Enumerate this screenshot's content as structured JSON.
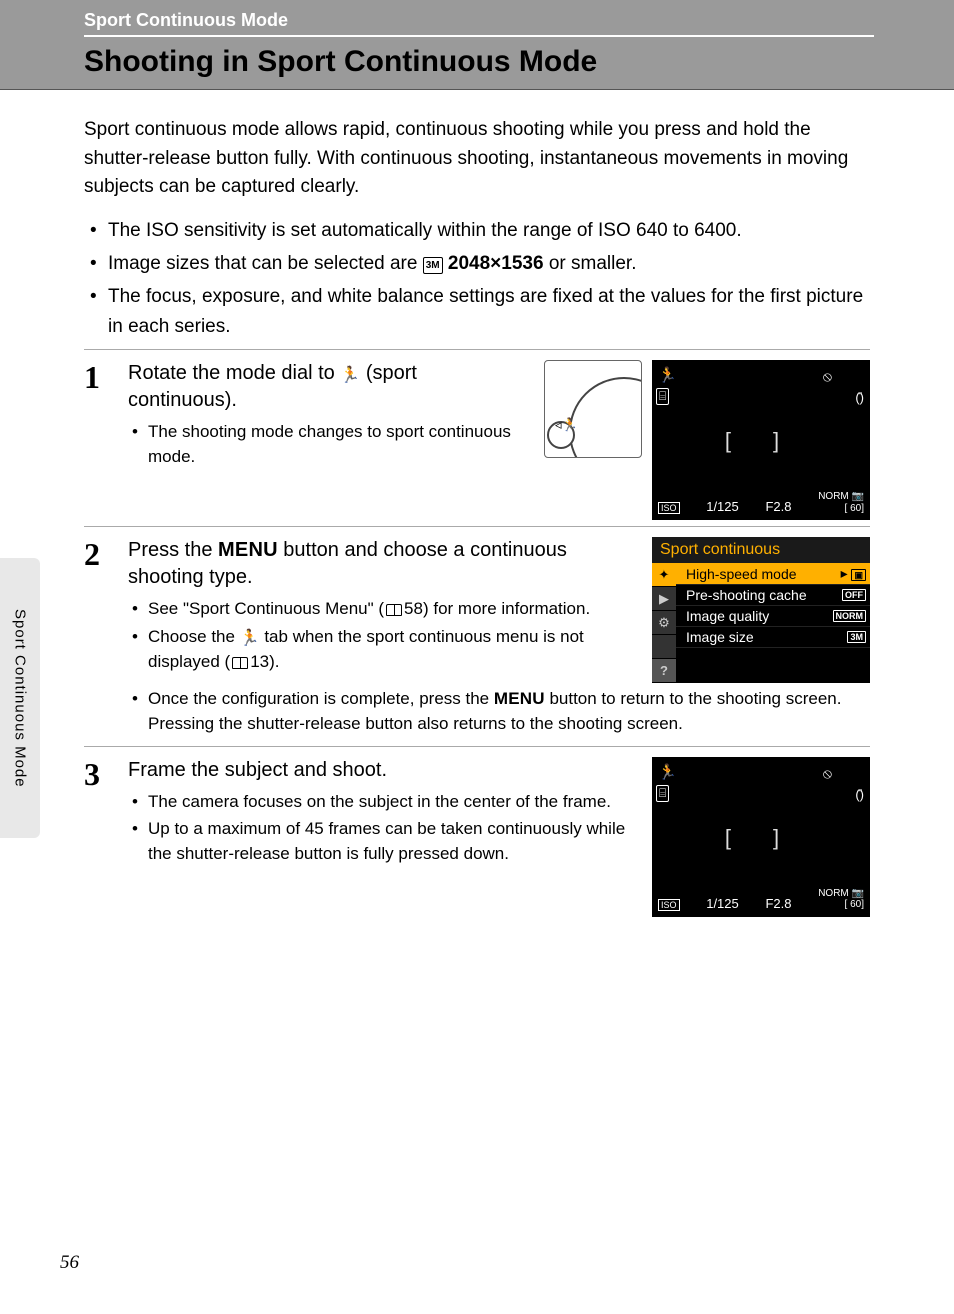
{
  "header": {
    "section": "Sport Continuous Mode",
    "title": "Shooting in Sport Continuous Mode"
  },
  "intro": "Sport continuous mode allows rapid, continuous shooting while you press and hold the shutter-release button fully. With continuous shooting, instantaneous movements in moving subjects can be captured clearly.",
  "intro_bullets": {
    "b1": "The ISO sensitivity is set automatically within the range of ISO 640 to 6400.",
    "b2_a": "Image sizes that can be selected are ",
    "b2_icon": "3M",
    "b2_b": " 2048×1536",
    "b2_c": " or smaller.",
    "b3": "The focus, exposure, and white balance settings are fixed at the values for the first picture in each series."
  },
  "steps": {
    "s1": {
      "num": "1",
      "title_a": "Rotate the mode dial to ",
      "title_b": " (sport continuous).",
      "bullets": {
        "b1": "The shooting mode changes to sport continuous mode."
      }
    },
    "s2": {
      "num": "2",
      "title_a": "Press the ",
      "title_menu": "MENU",
      "title_b": " button and choose a continuous shooting type.",
      "bullets": {
        "b1_a": "See \"Sport Continuous Menu\" (",
        "b1_ref": "58",
        "b1_b": ") for more information.",
        "b2_a": "Choose the ",
        "b2_b": " tab when the sport continuous menu is not displayed (",
        "b2_ref": "13",
        "b2_c": ").",
        "b3_a": "Once the configuration is complete, press the ",
        "b3_menu": "MENU",
        "b3_b": " button to return to the shooting screen. Pressing the shutter-release button also returns to the shooting screen."
      }
    },
    "s3": {
      "num": "3",
      "title": "Frame the subject and shoot.",
      "bullets": {
        "b1": "The camera focuses on the subject in the center of the frame.",
        "b2": "Up to a maximum of 45 frames can be taken continuously while the shutter-release button is fully pressed down."
      }
    }
  },
  "lcd": {
    "iso": "ISO",
    "shutter": "1/125",
    "aperture": "F2.8",
    "remaining_top": "NORM",
    "remaining": "60",
    "brackets": "[ ]",
    "card_icon": "⌸"
  },
  "menu_panel": {
    "title": "Sport continuous",
    "rows": {
      "r1": {
        "label": "High-speed mode",
        "val": "▣"
      },
      "r2": {
        "label": "Pre-shooting cache",
        "val": "OFF"
      },
      "r3": {
        "label": "Image quality",
        "val": "NORM"
      },
      "r4": {
        "label": "Image size",
        "val": "3M"
      }
    },
    "tabs": {
      "t1": "✦",
      "t2": "▶",
      "t3": "⚙",
      "t4": "?"
    }
  },
  "side_tab": "Sport Continuous Mode",
  "page_number": "56",
  "runner_glyph": "🏃"
}
